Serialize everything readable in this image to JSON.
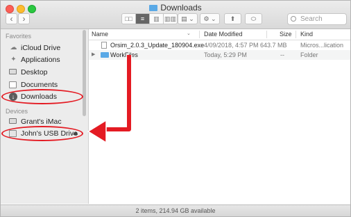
{
  "window": {
    "title": "Downloads"
  },
  "toolbar": {
    "back_icon": "‹",
    "forward_icon": "›",
    "view_icons": [
      "□□",
      "≡",
      "▥",
      "▥▥"
    ],
    "group_icon": "▤ ⌄",
    "action_icon": "⚙ ⌄",
    "share_icon": "⬆",
    "tag_icon": "⬭",
    "search_placeholder": "Search"
  },
  "sidebar": {
    "favorites_header": "Favorites",
    "devices_header": "Devices",
    "favorites": [
      {
        "label": "iCloud Drive",
        "icon": "cloud-icon"
      },
      {
        "label": "Applications",
        "icon": "applications-icon"
      },
      {
        "label": "Desktop",
        "icon": "desktop-icon"
      },
      {
        "label": "Documents",
        "icon": "documents-icon"
      },
      {
        "label": "Downloads",
        "icon": "downloads-icon"
      }
    ],
    "devices": [
      {
        "label": "Grant's iMac",
        "icon": "imac-icon"
      },
      {
        "label": "John's USB Drive",
        "icon": "usb-drive-icon",
        "eject": "⏏"
      }
    ]
  },
  "columns": {
    "name": "Name",
    "date": "Date Modified",
    "size": "Size",
    "kind": "Kind"
  },
  "files": [
    {
      "name": "Orsim_2.0.3_Update_180904.exe",
      "date": "4/09/2018, 4:57 PM",
      "size": "643.7 MB",
      "kind": "Micros...lication"
    },
    {
      "name": "WorkFiles",
      "date": "Today, 5:29 PM",
      "size": "--",
      "kind": "Folder"
    }
  ],
  "status": "2 items, 214.94 GB available",
  "colors": {
    "annotation": "#e41b23",
    "folder": "#5aa9e6"
  }
}
